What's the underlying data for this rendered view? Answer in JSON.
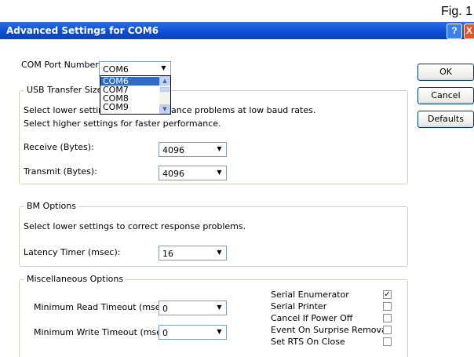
{
  "figure_label": "Fig. 1",
  "window": {
    "title": "Advanced Settings for COM6",
    "help_glyph": "?",
    "close_glyph": "X"
  },
  "com_port": {
    "label": "COM Port Number:",
    "value": "COM6",
    "options": [
      "COM6",
      "COM7",
      "COM8",
      "COM9"
    ]
  },
  "usb_transfer": {
    "legend": "USB Transfer Sizes",
    "hint_line1_start": "Select lower settin",
    "hint_line1_end": "ance problems at low baud rates.",
    "hint_line2": "Select higher settings for faster performance.",
    "receive": {
      "label": "Receive (Bytes):",
      "value": "4096"
    },
    "transmit": {
      "label": "Transmit (Bytes):",
      "value": "4096"
    }
  },
  "bm_options": {
    "legend": "BM Options",
    "hint": "Select lower settings to correct response problems.",
    "latency": {
      "label": "Latency Timer (msec):",
      "value": "16"
    }
  },
  "misc": {
    "legend": "Miscellaneous Options",
    "min_read": {
      "label": "Minimum Read Timeout (msec):",
      "value": "0"
    },
    "min_write": {
      "label": "Minimum Write Timeout (msec):",
      "value": "0"
    },
    "checks": [
      {
        "label": "Serial Enumerator",
        "checked": true
      },
      {
        "label": "Serial Printer",
        "checked": false
      },
      {
        "label": "Cancel If Power Off",
        "checked": false
      },
      {
        "label": "Event On Surprise Removal",
        "checked": false
      },
      {
        "label": "Set RTS On Close",
        "checked": false
      }
    ]
  },
  "buttons": {
    "ok": "OK",
    "cancel": "Cancel",
    "defaults": "Defaults"
  },
  "icons": {
    "dropdown_arrow": "▼",
    "scroll_up": "▲",
    "scroll_down": "▼",
    "check_mark": "✓"
  },
  "colors": {
    "titlebar": "#0a4bd0",
    "selection": "#316ac5",
    "button_border": "#003c74"
  }
}
